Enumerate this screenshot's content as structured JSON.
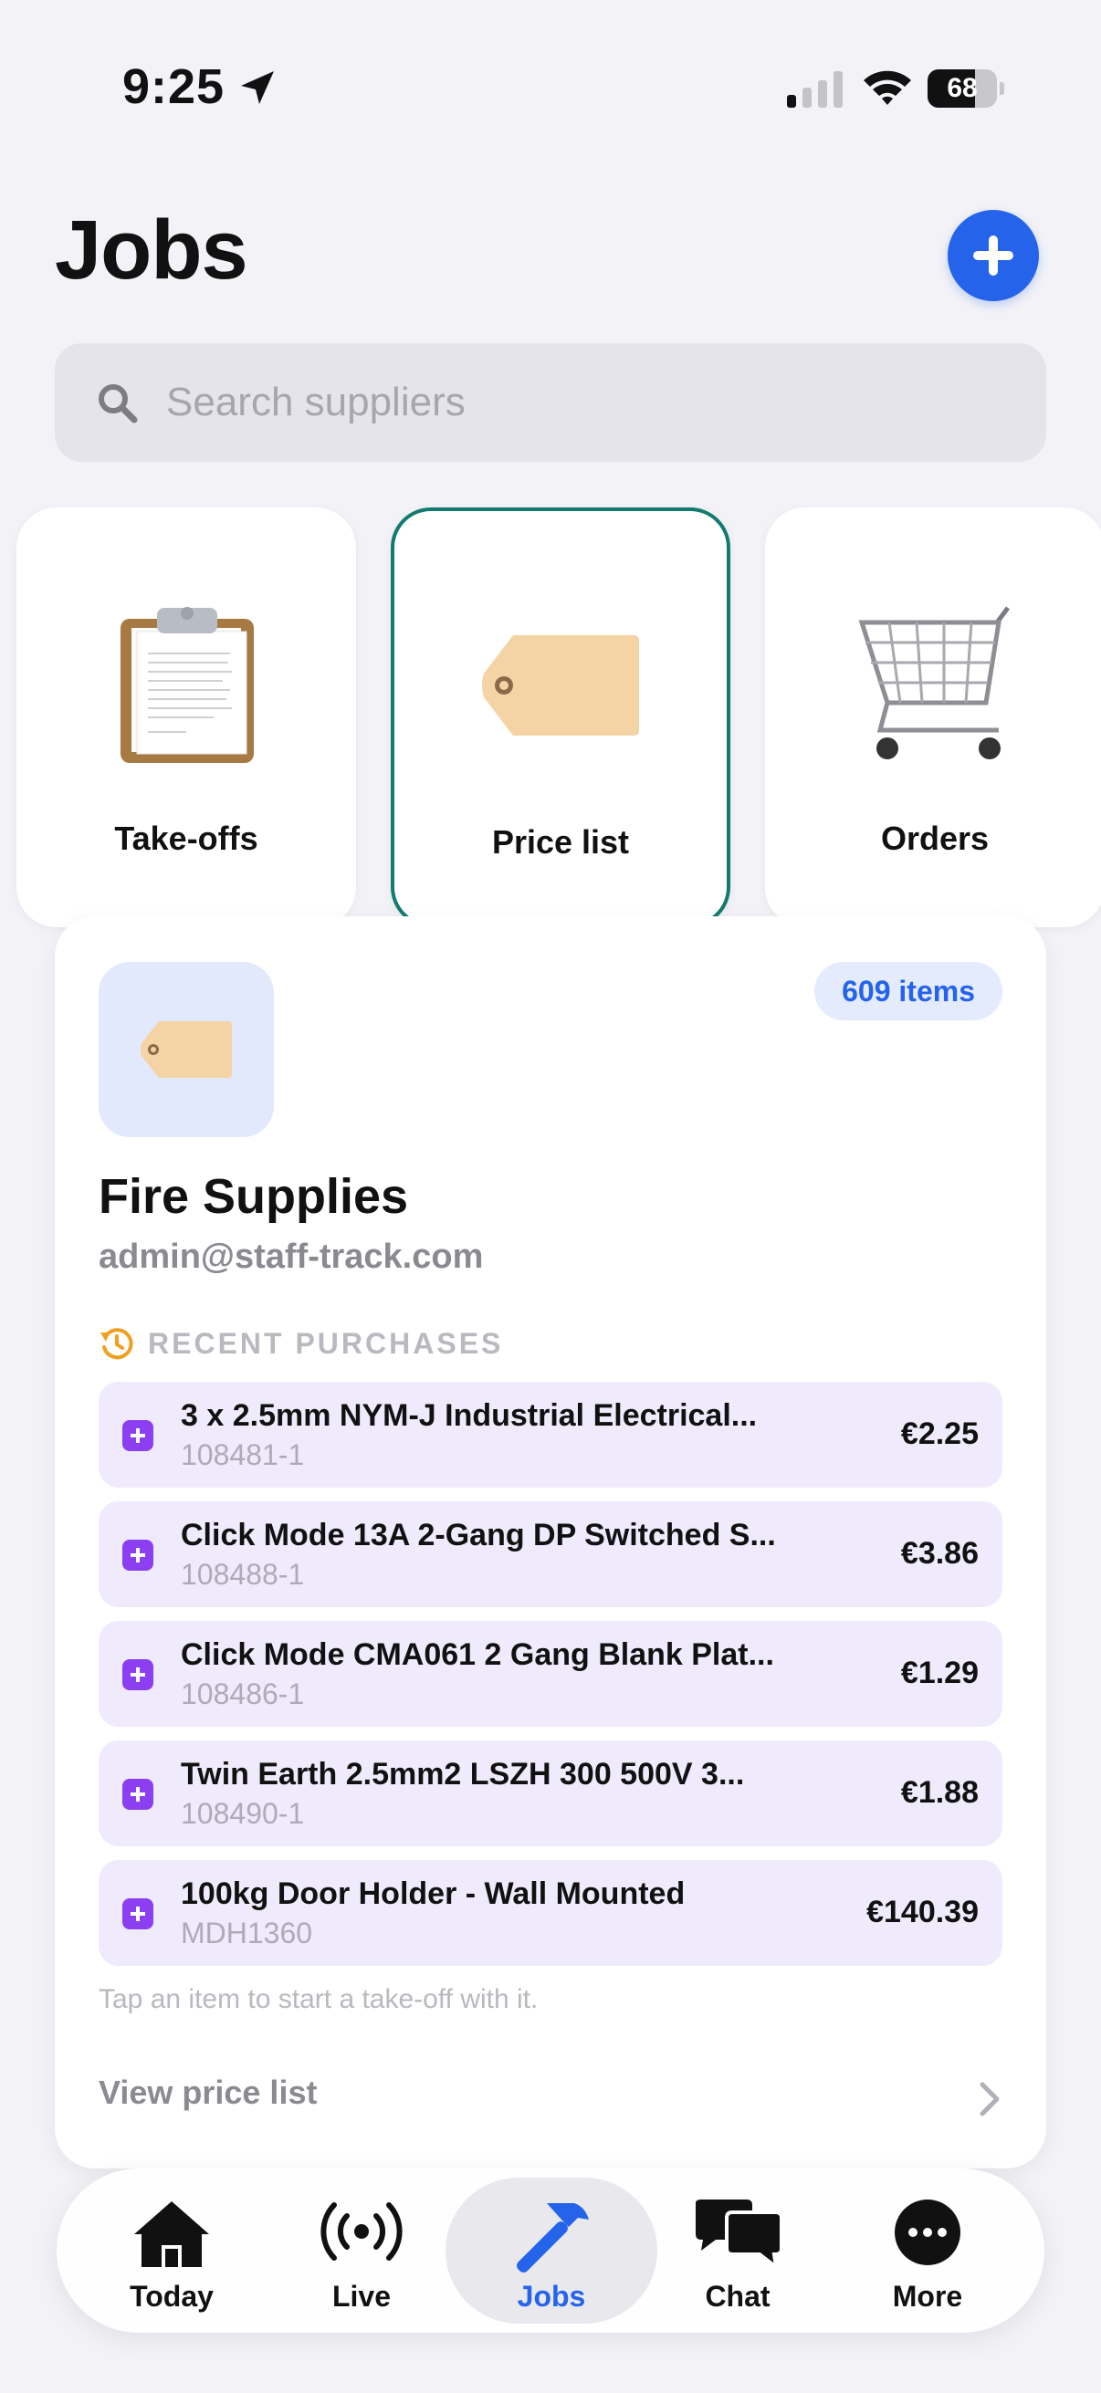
{
  "status_bar": {
    "time": "9:25",
    "battery_level": "68",
    "battery_fraction": 0.68
  },
  "header": {
    "title": "Jobs",
    "add_icon": "plus-icon",
    "accent_color": "#2563eb"
  },
  "search": {
    "placeholder": "Search suppliers",
    "value": ""
  },
  "categories": [
    {
      "label": "Take-offs",
      "icon": "clipboard-icon",
      "selected": false
    },
    {
      "label": "Price list",
      "icon": "price-tag-icon",
      "selected": true
    },
    {
      "label": "Orders",
      "icon": "shopping-cart-icon",
      "selected": false
    }
  ],
  "supplier": {
    "name": "Fire Supplies",
    "email": "admin@staff-track.com",
    "items_count": "609 items",
    "recent_title": "RECENT PURCHASES",
    "purchases": [
      {
        "name": "3 x 2.5mm NYM-J Industrial Electrical...",
        "code": "108481-1",
        "price": "€2.25"
      },
      {
        "name": "Click Mode 13A 2-Gang DP Switched S...",
        "code": "108488-1",
        "price": "€3.86"
      },
      {
        "name": "Click Mode CMA061 2 Gang Blank Plat...",
        "code": "108486-1",
        "price": "€1.29"
      },
      {
        "name": "Twin Earth 2.5mm2 LSZH 300 500V 3...",
        "code": "108490-1",
        "price": "€1.88"
      },
      {
        "name": "100kg Door Holder - Wall Mounted",
        "code": "MDH1360",
        "price": "€140.39"
      }
    ],
    "hint": "Tap an item to start a take-off with it.",
    "view_link": "View price list"
  },
  "tabs": [
    {
      "label": "Today",
      "icon": "house-icon",
      "active": false
    },
    {
      "label": "Live",
      "icon": "broadcast-icon",
      "active": false
    },
    {
      "label": "Jobs",
      "icon": "hammer-icon",
      "active": true
    },
    {
      "label": "Chat",
      "icon": "chat-bubbles-icon",
      "active": false
    },
    {
      "label": "More",
      "icon": "more-icon",
      "active": false
    }
  ]
}
